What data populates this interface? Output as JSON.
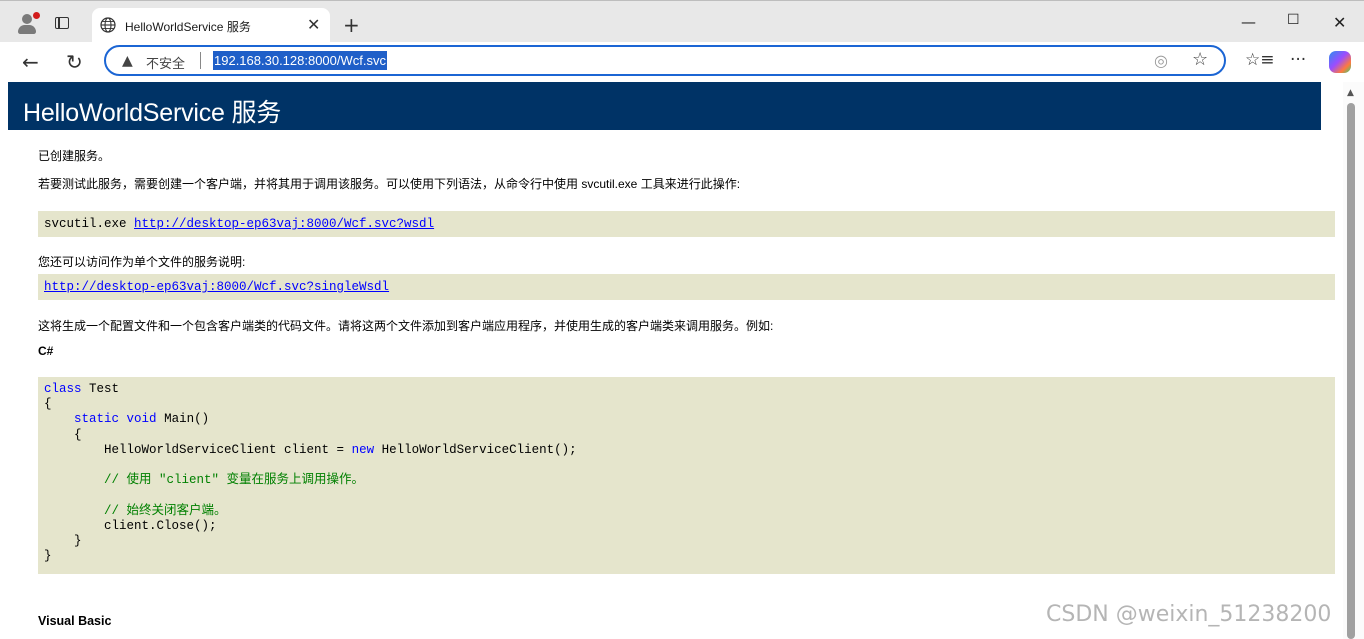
{
  "browser": {
    "tab_title": "HelloWorldService 服务",
    "insecure_label": "不安全",
    "url": "192.168.30.128:8000/Wcf.svc",
    "accent_color": "#1b65d4"
  },
  "page": {
    "heading": "HelloWorldService 服务",
    "created": "已创建服务。",
    "instructions": "若要测试此服务，需要创建一个客户端，并将其用于调用该服务。可以使用下列语法，从命令行中使用 svcutil.exe 工具来进行此操作:",
    "svcutil_cmd": "svcutil.exe ",
    "wsdl_link": "http://desktop-ep63vaj:8000/Wcf.svc?wsdl",
    "single_file_text": "您还可以访问作为单个文件的服务说明:",
    "single_wsdl_link": "http://desktop-ep63vaj:8000/Wcf.svc?singleWsdl",
    "generate_text": "这将生成一个配置文件和一个包含客户端类的代码文件。请将这两个文件添加到客户端应用程序，并使用生成的客户端类来调用服务。例如:",
    "csharp_label": "C#",
    "code": {
      "l1_kw": "class",
      "l1_rest": " Test",
      "l2": "{",
      "l3_indent": "    ",
      "l3_kw1": "static",
      "l3_kw2": "void",
      "l3_rest": " Main()",
      "l4": "    {",
      "l5_a": "        HelloWorldServiceClient client = ",
      "l5_kw": "new",
      "l5_b": " HelloWorldServiceClient();",
      "l6_comment": "        // 使用 \"client\" 变量在服务上调用操作。",
      "l7_comment": "        // 始终关闭客户端。",
      "l8": "        client.Close();",
      "l9": "    }",
      "l10": "}"
    },
    "vb_label": "Visual Basic"
  },
  "watermark": "CSDN @weixin_51238200"
}
